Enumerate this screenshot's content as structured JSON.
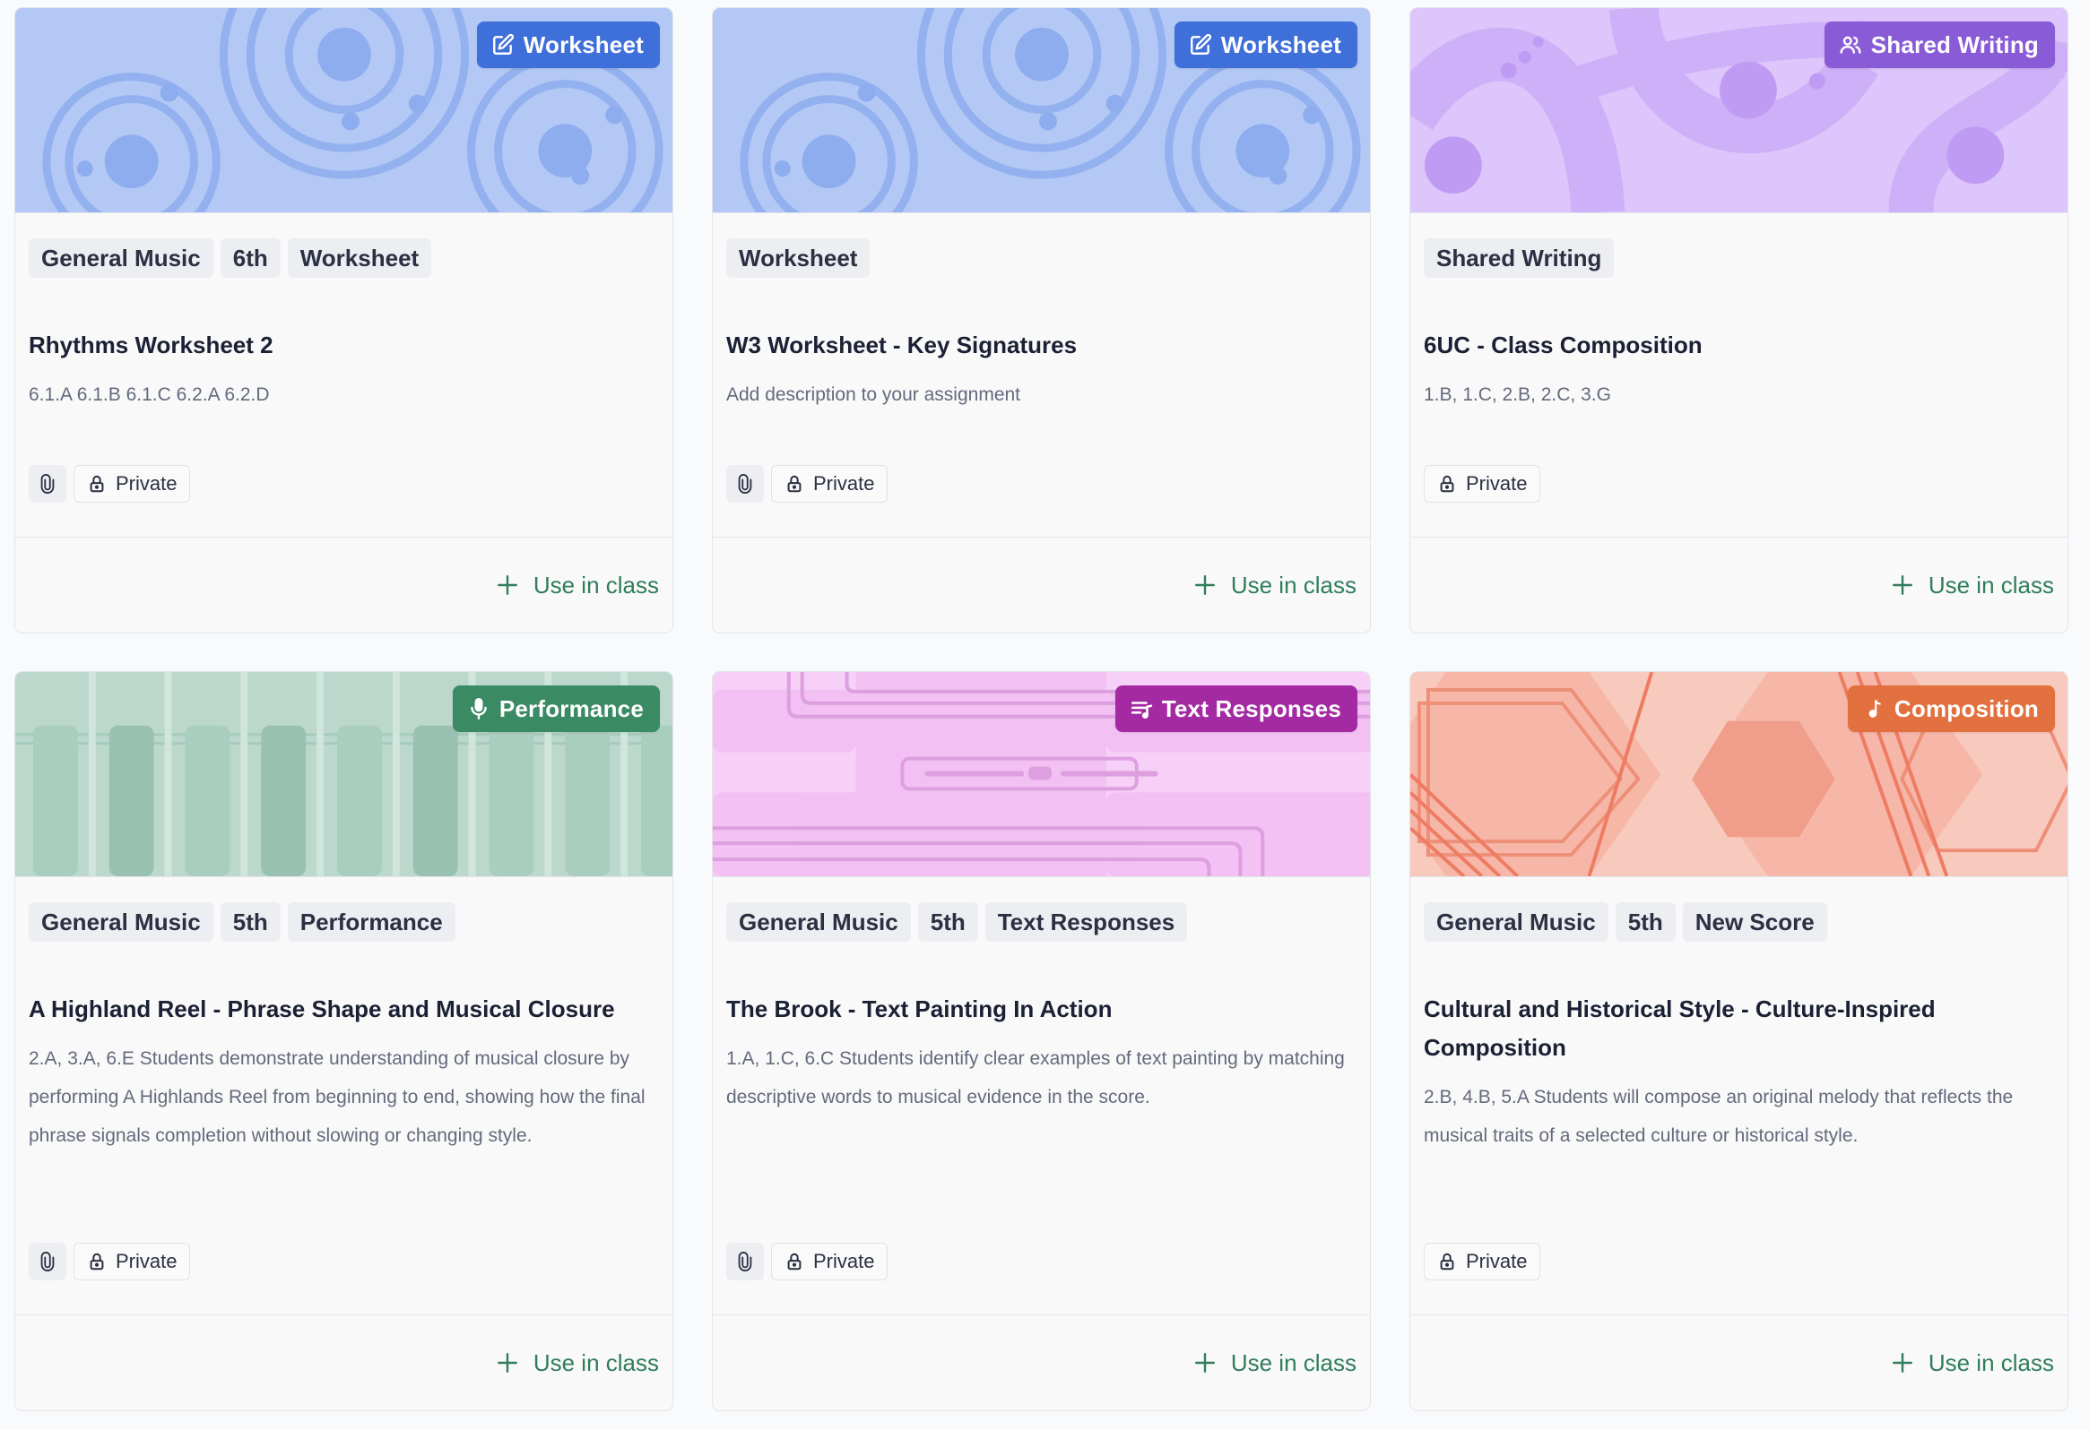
{
  "cards": [
    {
      "badge": "Worksheet",
      "badge_icon": "edit-icon",
      "badge_color": "#3f6fd8",
      "banner_color": "#b3c8f5",
      "tags": [
        "General Music",
        "6th",
        "Worksheet"
      ],
      "title": "Rhythms Worksheet 2",
      "description": "6.1.A 6.1.B 6.1.C 6.2.A 6.2.D",
      "has_attachment": true,
      "visibility": "Private",
      "action": "Use in class"
    },
    {
      "badge": "Worksheet",
      "badge_icon": "edit-icon",
      "badge_color": "#3f6fd8",
      "banner_color": "#b3c8f5",
      "tags": [
        "Worksheet"
      ],
      "title": "W3 Worksheet - Key Signatures",
      "description": "Add description to your assignment",
      "has_attachment": true,
      "visibility": "Private",
      "action": "Use in class"
    },
    {
      "badge": "Shared Writing",
      "badge_icon": "users-icon",
      "badge_color": "#8a5bd6",
      "banner_color": "#dcc6fb",
      "tags": [
        "Shared Writing"
      ],
      "title": "6UC - Class Composition",
      "description": "1.B, 1.C, 2.B, 2.C, 3.G",
      "has_attachment": false,
      "visibility": "Private",
      "action": "Use in class"
    },
    {
      "badge": "Performance",
      "badge_icon": "microphone-icon",
      "badge_color": "#3a8a64",
      "banner_color": "#bcd8cd",
      "tags": [
        "General Music",
        "5th",
        "Performance"
      ],
      "title": "A Highland Reel - Phrase Shape and Musical Closure",
      "description": "2.A, 3.A, 6.E Students demonstrate understanding of musical closure by performing A Highlands Reel from beginning to end, showing how the final phrase signals completion without slowing or changing style.",
      "has_attachment": true,
      "visibility": "Private",
      "action": "Use in class"
    },
    {
      "badge": "Text Responses",
      "badge_icon": "text-lines-icon",
      "badge_color": "#a42aa4",
      "banner_color": "#f6d0f6",
      "tags": [
        "General Music",
        "5th",
        "Text Responses"
      ],
      "title": "The Brook - Text Painting In Action",
      "description": "1.A, 1.C, 6.C Students identify clear examples of text painting by matching descriptive words to musical evidence in the score.",
      "has_attachment": true,
      "visibility": "Private",
      "action": "Use in class"
    },
    {
      "badge": "Composition",
      "badge_icon": "music-note-icon",
      "badge_color": "#e2713f",
      "banner_color": "#f8c9bd",
      "tags": [
        "General Music",
        "5th",
        "New Score"
      ],
      "title": "Cultural and Historical Style - Culture-Inspired Composition",
      "description": "2.B, 4.B, 5.A Students will compose an original melody that reflects the musical traits of a selected culture or historical style.",
      "has_attachment": false,
      "visibility": "Private",
      "action": "Use in class"
    }
  ]
}
